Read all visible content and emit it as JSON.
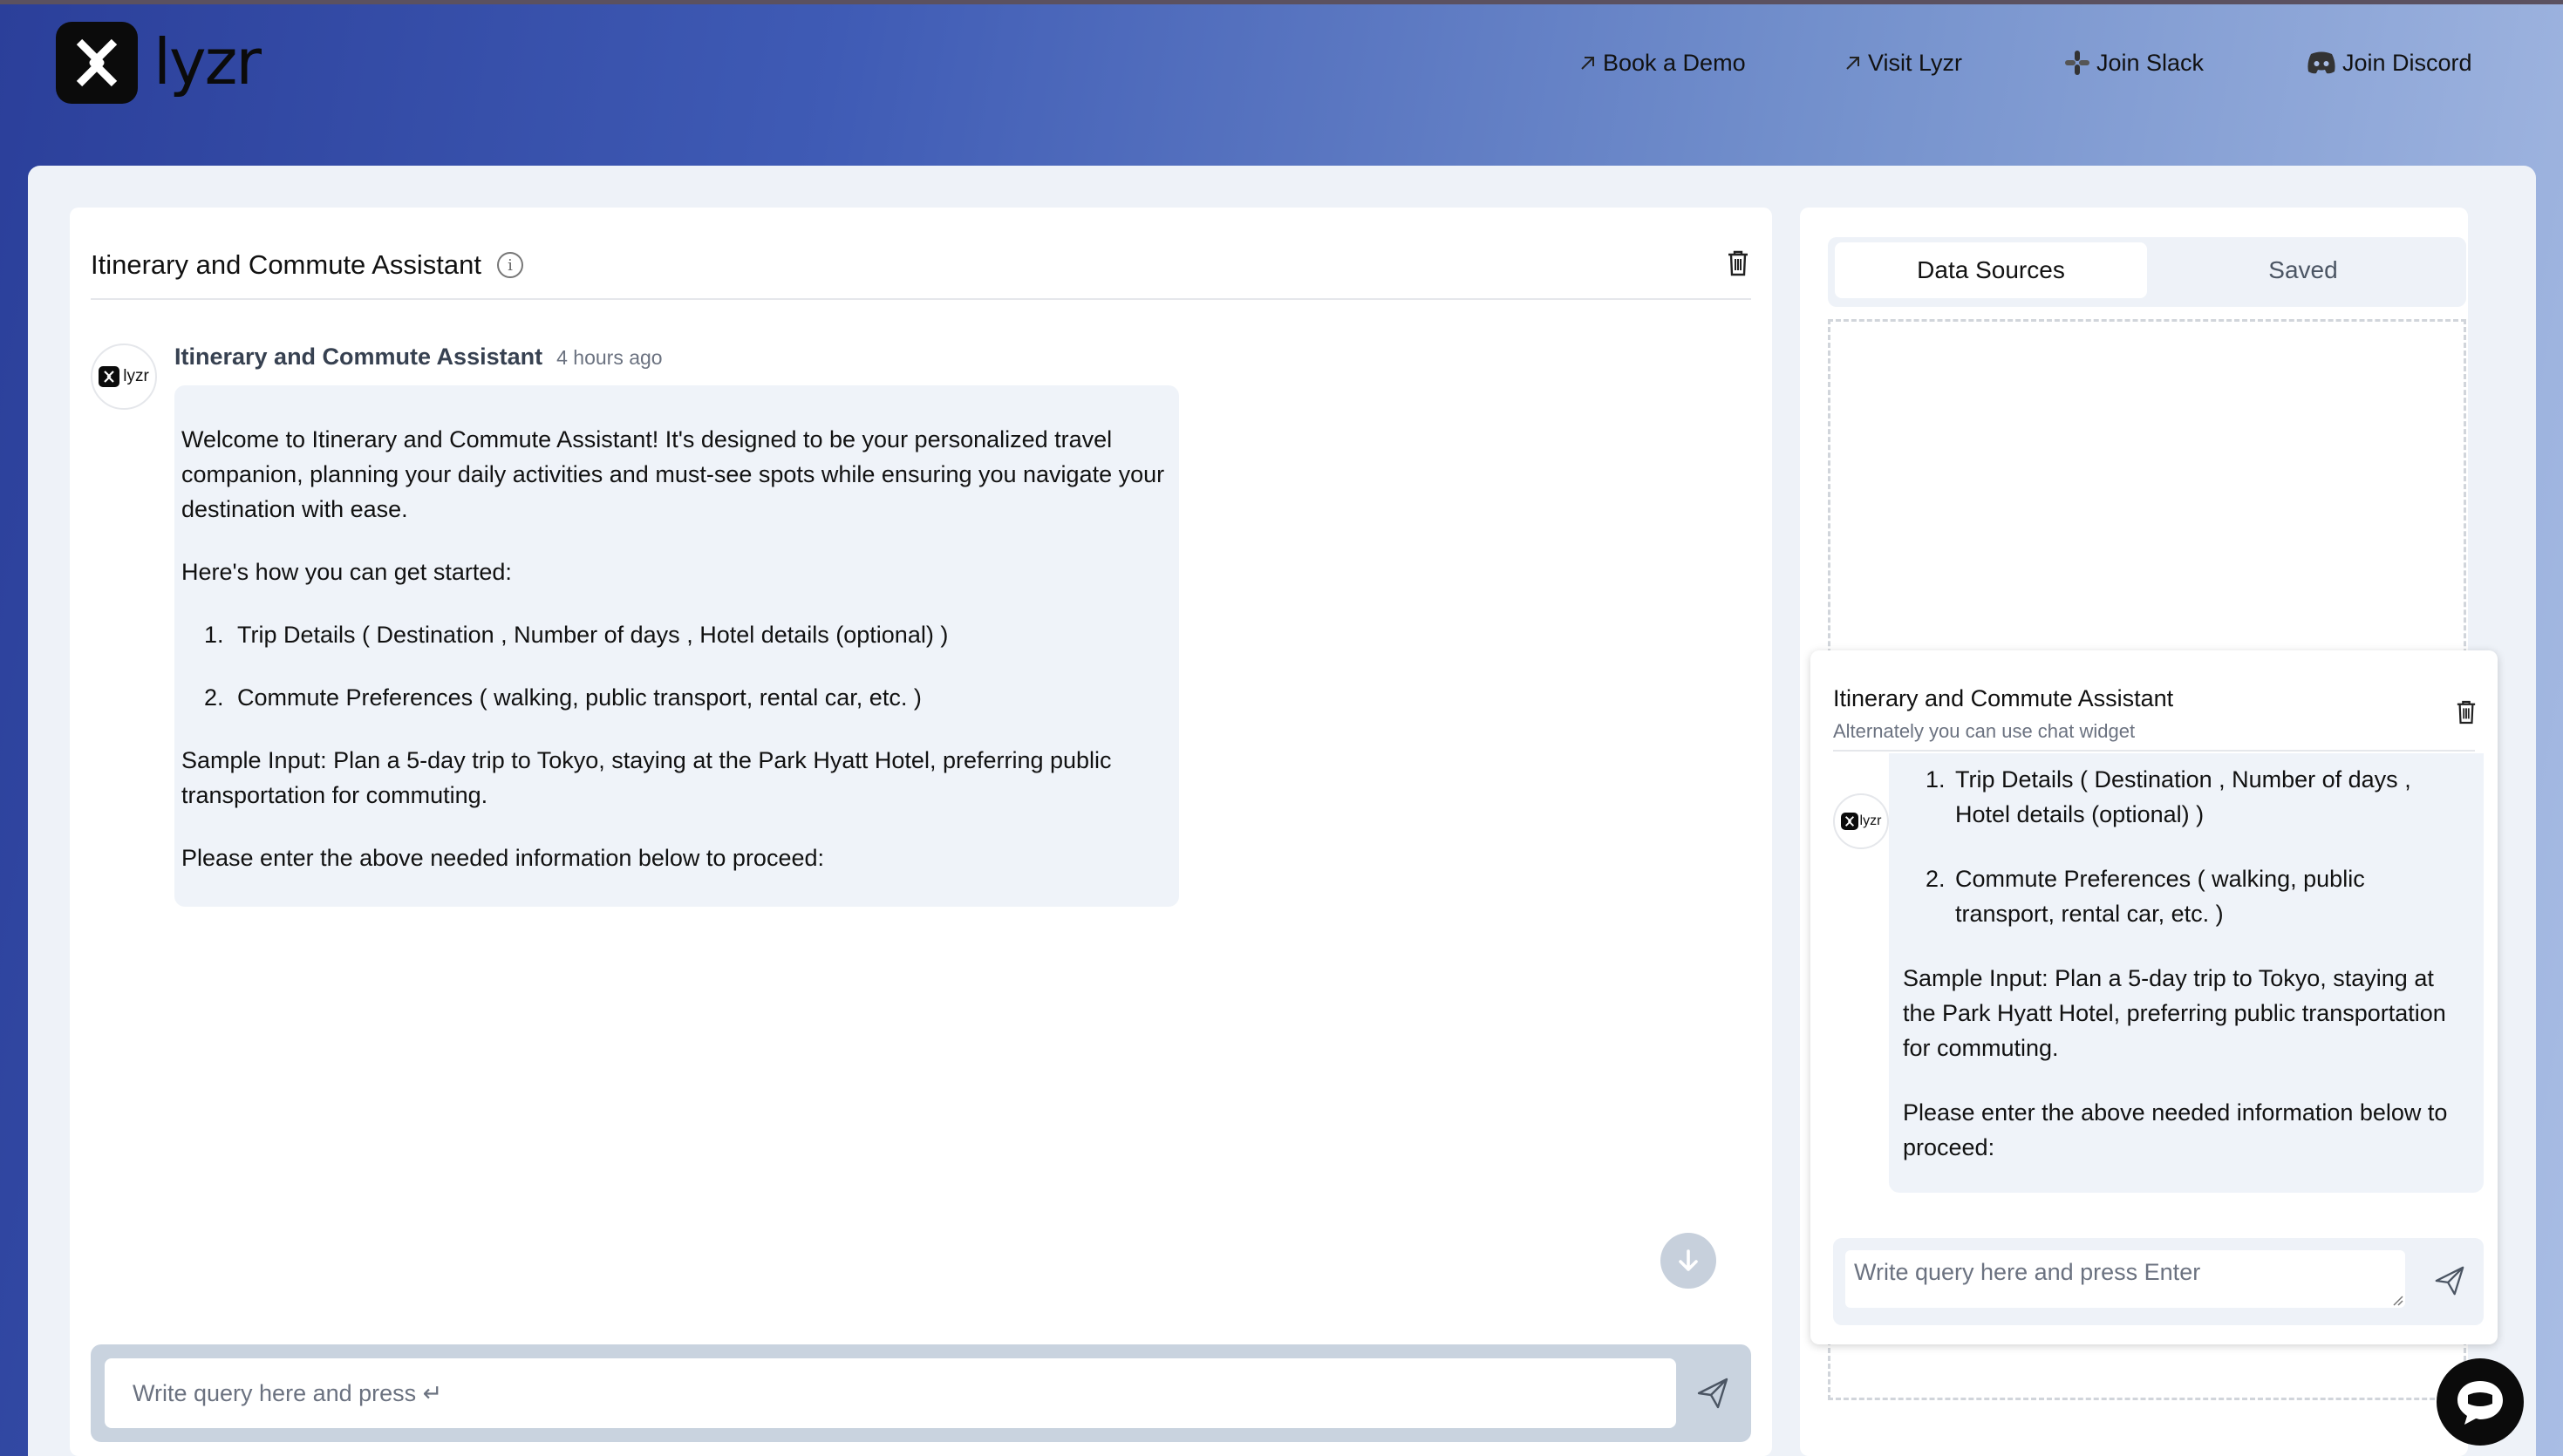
{
  "header": {
    "logo_text": "lyzr",
    "nav": [
      {
        "icon": "arrow-up-right-icon",
        "label": "Book a Demo"
      },
      {
        "icon": "arrow-up-right-icon",
        "label": "Visit Lyzr"
      },
      {
        "icon": "slack-icon",
        "label": "Join Slack"
      },
      {
        "icon": "discord-icon",
        "label": "Join Discord"
      }
    ]
  },
  "chat": {
    "title": "Itinerary and Commute Assistant",
    "avatar_text": "lyzr",
    "message": {
      "sender": "Itinerary and Commute Assistant",
      "time": "4 hours ago",
      "intro": "Welcome to Itinerary and Commute Assistant! It's designed to be your personalized travel companion, planning your daily activities and must-see spots while ensuring you navigate your destination with ease.",
      "started": "Here's how you can get started:",
      "steps": [
        "Trip Details ( Destination , Number of days , Hotel details (optional) )",
        "Commute Preferences ( walking, public transport, rental car, etc. )"
      ],
      "sample": "Sample Input: Plan a 5-day trip to Tokyo, staying at the Park Hyatt Hotel, preferring public transportation for commuting.",
      "proceed": "Please enter the above needed information below to proceed:"
    },
    "input_placeholder": "Write query here and press ↵"
  },
  "sidebar": {
    "tabs": [
      {
        "label": "Data Sources",
        "active": true
      },
      {
        "label": "Saved",
        "active": false
      }
    ]
  },
  "widget": {
    "title": "Itinerary and Commute Assistant",
    "subtitle": "Alternately you can use chat widget",
    "avatar_text": "lyzr",
    "steps": [
      "Trip Details ( Destination , Number of days , Hotel details (optional) )",
      "Commute Preferences ( walking, public transport, rental car, etc. )"
    ],
    "sample": "Sample Input: Plan a 5-day trip to Tokyo, staying at the Park Hyatt Hotel, preferring public transportation for commuting.",
    "proceed": "Please enter the above needed information below to proceed:",
    "input_placeholder": "Write query here and press Enter"
  }
}
